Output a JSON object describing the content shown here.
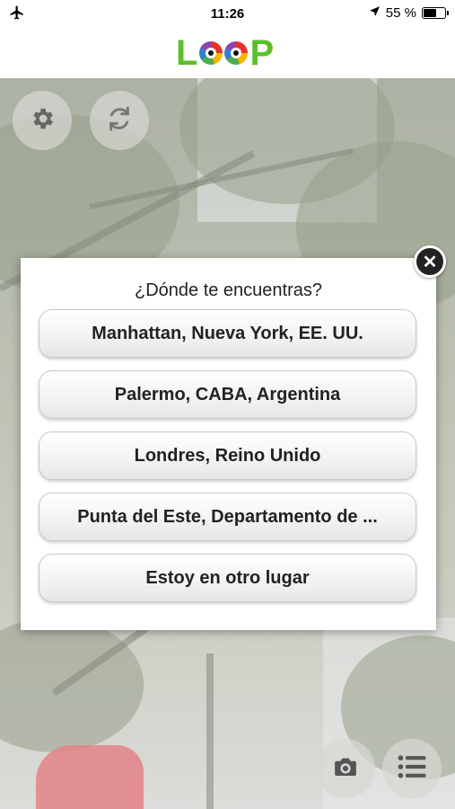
{
  "status_bar": {
    "time": "11:26",
    "battery_percent": "55 %",
    "battery_level": 0.55,
    "icons": [
      "airplane-icon",
      "location-arrow-icon",
      "battery-icon"
    ]
  },
  "header": {
    "logo_text": "LOOP",
    "brand_color": "#5cbf2a"
  },
  "camera": {
    "left_buttons": [
      "gear-icon",
      "refresh-icon"
    ],
    "bottom_buttons": [
      "camera-icon",
      "list-icon"
    ]
  },
  "dialog": {
    "title": "¿Dónde te encuentras?",
    "options": [
      {
        "label": "Manhattan, Nueva York, EE. UU."
      },
      {
        "label": "Palermo, CABA, Argentina"
      },
      {
        "label": "Londres, Reino Unido"
      },
      {
        "label": "Punta del Este, Departamento de ..."
      },
      {
        "label": "Estoy en otro lugar"
      }
    ],
    "close_icon": "close-icon"
  }
}
